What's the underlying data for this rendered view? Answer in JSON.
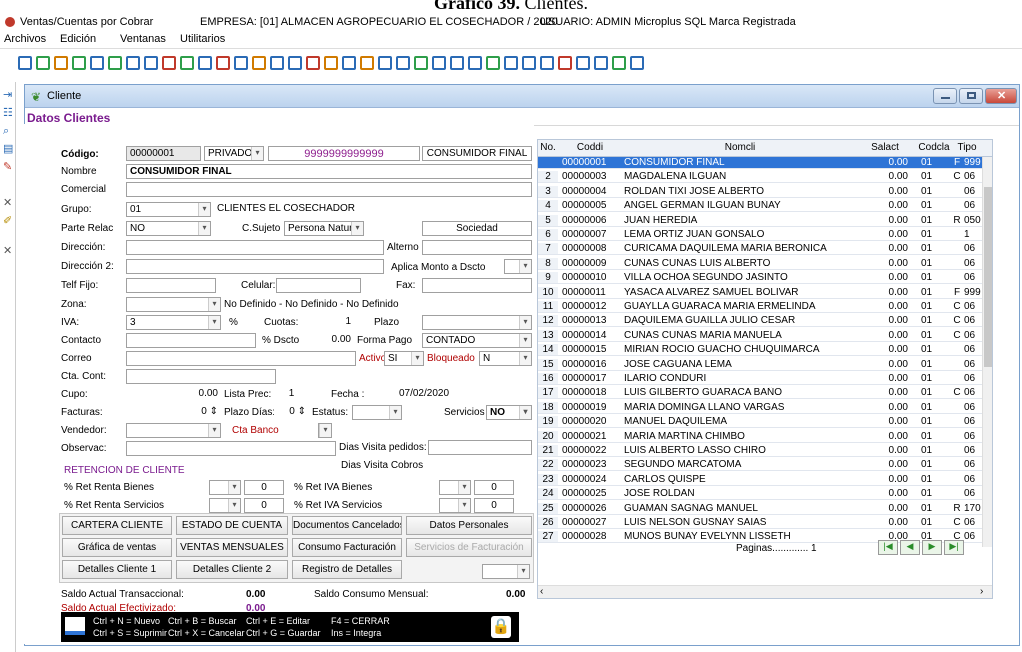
{
  "caption": {
    "prefix": "Gráfico 39.",
    "text": "Clientes."
  },
  "titlebar": {
    "app": "Ventas/Cuentas por Cobrar",
    "empresa": "EMPRESA: [01] ALMACEN AGROPECUARIO EL COSECHADOR / 2020",
    "usuario": "USUARIO: ADMIN  Microplus SQL Marca Registrada"
  },
  "menu": [
    "Archivos",
    "Edición",
    "Ventanas",
    "Utilitarios"
  ],
  "window": {
    "title": "Cliente",
    "section": "Datos Clientes"
  },
  "form": {
    "codigo_label": "Código:",
    "codigo": "00000001",
    "tipo": "PRIVADO",
    "ruc": "9999999999999",
    "tipo_cliente": "CONSUMIDOR FINAL",
    "nombre_label": "Nombre",
    "nombre": "CONSUMIDOR FINAL",
    "comercial_label": "Comercial",
    "grupo_label": "Grupo:",
    "grupo": "01",
    "grupo_desc": "CLIENTES EL COSECHADOR",
    "parte_relac_label": "Parte Relac",
    "parte_relac": "NO",
    "csujeto_label": "C.Sujeto",
    "csujeto": "Persona Natural",
    "sociedad": "Sociedad",
    "direccion_label": "Dirección:",
    "alterno_label": "Alterno",
    "direccion2_label": "Dirección 2:",
    "aplica_label": "Aplica Monto a Dscto",
    "telf_label": "Telf Fijo:",
    "celular_label": "Celular:",
    "fax_label": "Fax:",
    "zona_label": "Zona:",
    "zona_desc": "No Definido - No Definido - No Definido",
    "iva_label": "IVA:",
    "iva": "3",
    "pct": "%",
    "cuotas_label": "Cuotas:",
    "cuotas": "1",
    "plazo_label": "Plazo",
    "contacto_label": "Contacto",
    "pdscto_label": "% Dscto",
    "pdscto": "0.00",
    "forma_pago_label": "Forma Pago",
    "forma_pago": "CONTADO",
    "correo_label": "Correo",
    "activo_label": "Activo:",
    "activo": "SI",
    "bloqueado_label": "Bloqueado",
    "bloqueado": "N",
    "cta_label": "Cta. Cont:",
    "cupo_label": "Cupo:",
    "cupo": "0.00",
    "lista_label": "Lista Prec:",
    "lista": "1",
    "fecha_label": "Fecha :",
    "fecha": "07/02/2020",
    "facturas_label": "Facturas:",
    "facturas": "0",
    "plazo_dias_label": "Plazo Días:",
    "plazo_dias": "0",
    "estatus_label": "Estatus:",
    "servicios_label": "Servicios",
    "servicios": "NO",
    "vendedor_label": "Vendedor:",
    "cta_banco_label": "Cta Banco",
    "observ_label": "Observac:",
    "dias_visita_pedidos": "Dias Visita pedidos:",
    "dias_visita_cobros": "Dias Visita Cobros",
    "retencion_title": "RETENCION DE CLIENTE",
    "ret_renta_bienes": "% Ret Renta Bienes",
    "ret_renta_bienes_val": "0",
    "ret_iva_bienes": "% Ret IVA Bienes",
    "ret_iva_bienes_val": "0",
    "ret_renta_serv": "% Ret Renta Servicios",
    "ret_renta_serv_val": "0",
    "ret_iva_serv": "% Ret IVA Servicios",
    "ret_iva_serv_val": "0",
    "buttons": [
      "CARTERA CLIENTE",
      "ESTADO DE CUENTA",
      "Documentos Cancelados",
      "Datos Personales",
      "Gráfica de ventas",
      "VENTAS MENSUALES",
      "Consumo Facturación",
      "Servicios de Facturación",
      "Detalles Cliente 1",
      "Detalles Cliente 2",
      "Registro de Detalles"
    ],
    "saldo_trans_label": "Saldo Actual Transaccional:",
    "saldo_trans": "0.00",
    "saldo_consumo_label": "Saldo Consumo Mensual:",
    "saldo_consumo": "0.00",
    "saldo_efect_label": "Saldo Actual Efectivizado:",
    "saldo_efect": "0.00",
    "shortcuts": [
      "Ctrl + N = Nuevo",
      "Ctrl + B = Buscar",
      "Ctrl + E = Editar",
      "F4 = CERRAR",
      "Ctrl + S = Suprimir",
      "Ctrl + X = Cancelar",
      "Ctrl + G = Guardar",
      "Ins = Integra"
    ]
  },
  "grid": {
    "headers": [
      "No.",
      "Coddi",
      "Nomcli",
      "Salact",
      "Codcla",
      "Tipo"
    ],
    "rows": [
      [
        "00000001",
        "CONSUMIDOR FINAL",
        "0.00",
        "01",
        "F",
        "999"
      ],
      [
        "00000003",
        "MAGDALENA ILGUAN",
        "0.00",
        "01",
        "C",
        "06"
      ],
      [
        "00000004",
        "ROLDAN TIXI JOSE ALBERTO",
        "0.00",
        "01",
        "",
        "06"
      ],
      [
        "00000005",
        "ANGEL GERMAN ILGUAN BUÑAY",
        "0.00",
        "01",
        "",
        "06"
      ],
      [
        "00000006",
        "JUAN HEREDIA",
        "0.00",
        "01",
        "R",
        "050"
      ],
      [
        "00000007",
        "LEMA ORTIZ JUAN GONSALO",
        "0.00",
        "01",
        "",
        "1"
      ],
      [
        "00000008",
        "CURICAMA DAQUILEMA MARIA BERONICA",
        "0.00",
        "01",
        "",
        "06"
      ],
      [
        "00000009",
        "CUÑAS CUÑAS LUIS ALBERTO",
        "0.00",
        "01",
        "",
        "06"
      ],
      [
        "00000010",
        "VILLA OCHOA SEGUNDO JASINTO",
        "0.00",
        "01",
        "",
        "06"
      ],
      [
        "00000011",
        "YASACA ALVAREZ SAMUEL BOLIVAR",
        "0.00",
        "01",
        "F",
        "999"
      ],
      [
        "00000012",
        "GUAYLLA GUARACA MARIA ERMELINDA",
        "0.00",
        "01",
        "C",
        "06"
      ],
      [
        "00000013",
        "DAQUILEMA GUAILLA JULIO CESAR",
        "0.00",
        "01",
        "C",
        "06"
      ],
      [
        "00000014",
        "CUÑAS CUÑAS MARIA MANUELA",
        "0.00",
        "01",
        "C",
        "06"
      ],
      [
        "00000015",
        "MIRIAN ROCIO GUACHO CHUQUIMARCA",
        "0.00",
        "01",
        "",
        "06"
      ],
      [
        "00000016",
        "JOSE CAGUANA LEMA",
        "0.00",
        "01",
        "",
        "06"
      ],
      [
        "00000017",
        "ILARIO CONDURI",
        "0.00",
        "01",
        "",
        "06"
      ],
      [
        "00000018",
        "LUIS GILBERTO GUARACA BAÑO",
        "0.00",
        "01",
        "C",
        "06"
      ],
      [
        "00000019",
        "MARIA DOMINGA LLANO VARGAS",
        "0.00",
        "01",
        "",
        "06"
      ],
      [
        "00000020",
        "MANUEL DAQUILEMA",
        "0.00",
        "01",
        "",
        "06"
      ],
      [
        "00000021",
        "MARIA MARTINA CHIMBO",
        "0.00",
        "01",
        "",
        "06"
      ],
      [
        "00000022",
        "LUIS ALBERTO LASSO CHIRO",
        "0.00",
        "01",
        "",
        "06"
      ],
      [
        "00000023",
        "SEGUNDO MARCATOMA",
        "0.00",
        "01",
        "",
        "06"
      ],
      [
        "00000024",
        "CARLOS QUISPE",
        "0.00",
        "01",
        "",
        "06"
      ],
      [
        "00000025",
        "JOSE ROLDAN",
        "0.00",
        "01",
        "",
        "06"
      ],
      [
        "00000026",
        "GUAMAN SAGÑAG MANUEL",
        "0.00",
        "01",
        "R",
        "170"
      ],
      [
        "00000027",
        "LUIS NELSON GUSÑAY SAIAS",
        "0.00",
        "01",
        "C",
        "06"
      ],
      [
        "00000028",
        "MUÑOS BUÑAY EVELYNN LISSETH",
        "0.00",
        "01",
        "C",
        "06"
      ]
    ],
    "row_numbers": [
      "",
      "2",
      "3",
      "4",
      "5",
      "6",
      "7",
      "8",
      "9",
      "10",
      "11",
      "12",
      "13",
      "14",
      "15",
      "16",
      "17",
      "18",
      "19",
      "20",
      "21",
      "22",
      "23",
      "24",
      "25",
      "26",
      "27"
    ],
    "paginas": "Paginas............. 1"
  }
}
